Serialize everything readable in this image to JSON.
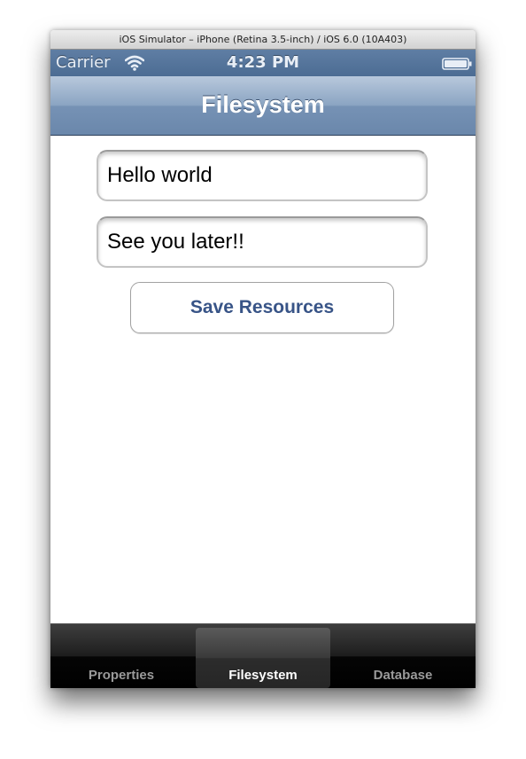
{
  "window": {
    "title": "iOS Simulator – iPhone (Retina 3.5-inch) / iOS 6.0 (10A403)"
  },
  "statusbar": {
    "carrier": "Carrier",
    "time": "4:23 PM",
    "wifi_icon": "wifi-icon",
    "battery_icon": "battery-icon"
  },
  "navbar": {
    "title": "Filesystem",
    "gradient_top": "#b8c8dc",
    "gradient_bottom": "#6a87ab"
  },
  "form": {
    "field1_value": "Hello world",
    "field2_value": "See you later!!",
    "save_label": "Save Resources",
    "button_text_color": "#385487"
  },
  "tabbar": {
    "tabs": [
      {
        "label": "Properties",
        "selected": false
      },
      {
        "label": "Filesystem",
        "selected": true
      },
      {
        "label": "Database",
        "selected": false
      }
    ]
  }
}
